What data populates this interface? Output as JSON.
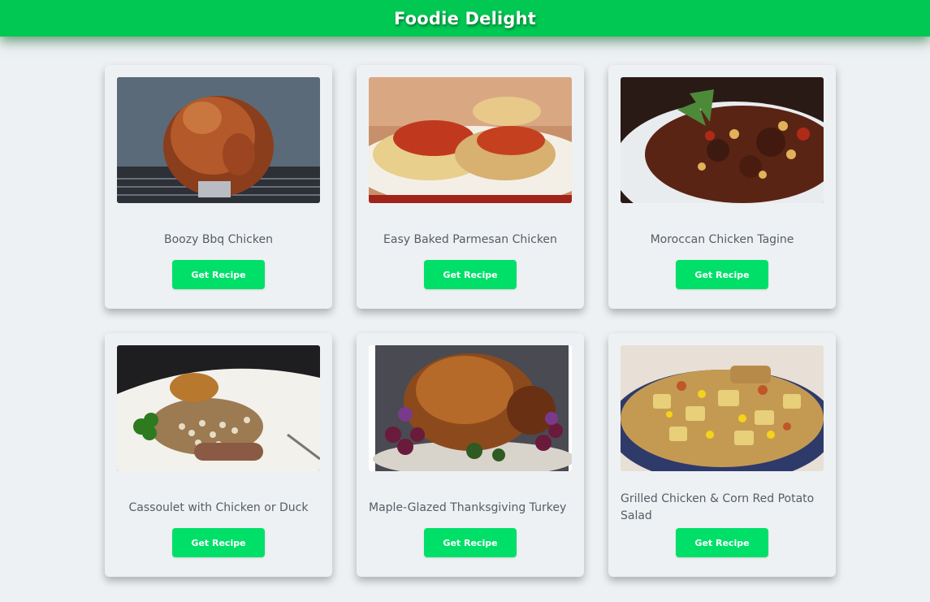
{
  "header": {
    "title": "Foodie Delight"
  },
  "recipes": [
    {
      "title": "Boozy Bbq Chicken",
      "button": "Get Recipe"
    },
    {
      "title": "Easy Baked Parmesan Chicken",
      "button": "Get Recipe"
    },
    {
      "title": "Moroccan Chicken Tagine",
      "button": "Get Recipe"
    },
    {
      "title": "Cassoulet with Chicken or Duck",
      "button": "Get Recipe"
    },
    {
      "title": "Maple-Glazed Thanksgiving Turkey",
      "button": "Get Recipe"
    },
    {
      "title": "Grilled Chicken & Corn Red Potato Salad",
      "button": "Get Recipe"
    }
  ],
  "colors": {
    "header": "#00c853",
    "button": "#00e069",
    "background": "#eef1f3",
    "title_text": "#555d66"
  }
}
